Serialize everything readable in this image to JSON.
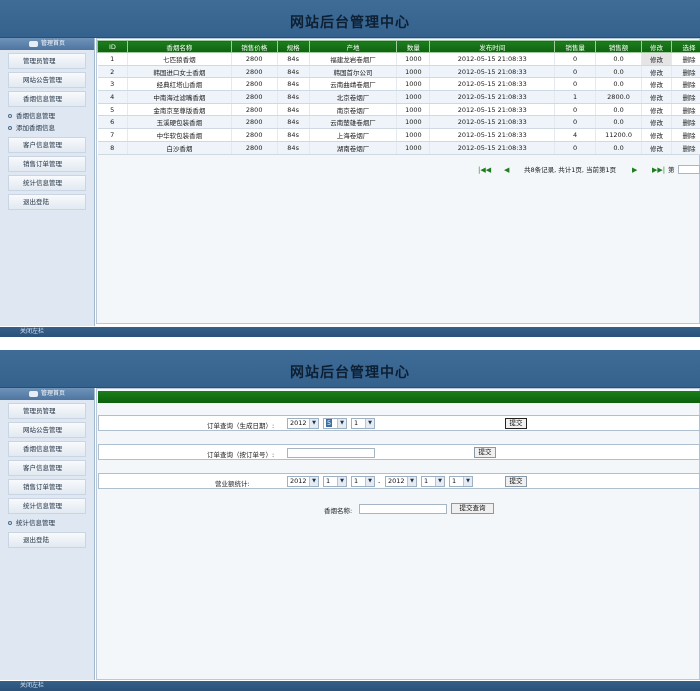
{
  "app": {
    "title": "网站后台管理中心",
    "footer_text": "关闭左栏"
  },
  "sidebar_top": {
    "header": "管理首页",
    "items": [
      "管理员管理",
      "网站公告管理",
      "香烟信息管理"
    ],
    "sub_items": [
      "香烟信息管理",
      "添加香烟信息"
    ],
    "items_after": [
      "客户信息管理",
      "销售订单管理",
      "统计信息管理",
      "退出登陆"
    ]
  },
  "sidebar_bottom": {
    "header": "管理首页",
    "items": [
      "管理员管理",
      "网站公告管理",
      "香烟信息管理",
      "客户信息管理",
      "销售订单管理",
      "统计信息管理"
    ],
    "sub_items": [
      "统计信息管理"
    ],
    "items_after": [
      "退出登陆"
    ]
  },
  "table": {
    "columns": [
      "ID",
      "香烟名称",
      "销售价格",
      "规格",
      "产地",
      "数量",
      "发布时间",
      "销售量",
      "销售额",
      "修改",
      "选择"
    ],
    "rows": [
      [
        "1",
        "七匹狼香烟",
        "2800",
        "84s",
        "福建龙岩卷烟厂",
        "1000",
        "2012-05-15 21:08:33",
        "0",
        "0.0",
        "修改",
        "删除"
      ],
      [
        "2",
        "韩国进口女士香烟",
        "2800",
        "84s",
        "韩国首尔公司",
        "1000",
        "2012-05-15 21:08:33",
        "0",
        "0.0",
        "修改",
        "删除"
      ],
      [
        "3",
        "经典红塔山香烟",
        "2800",
        "84s",
        "云南曲靖卷烟厂",
        "1000",
        "2012-05-15 21:08:33",
        "0",
        "0.0",
        "修改",
        "删除"
      ],
      [
        "4",
        "中南海过滤嘴香烟",
        "2800",
        "84s",
        "北京卷烟厂",
        "1000",
        "2012-05-15 21:08:33",
        "1",
        "2800.0",
        "修改",
        "删除"
      ],
      [
        "5",
        "金南京至尊版香烟",
        "2800",
        "84s",
        "南京卷烟厂",
        "1000",
        "2012-05-15 21:08:33",
        "0",
        "0.0",
        "修改",
        "删除"
      ],
      [
        "6",
        "玉溪硬包装香烟",
        "2800",
        "84s",
        "云南楚雄卷烟厂",
        "1000",
        "2012-05-15 21:08:33",
        "0",
        "0.0",
        "修改",
        "删除"
      ],
      [
        "7",
        "中华软包装香烟",
        "2800",
        "84s",
        "上海卷烟厂",
        "1000",
        "2012-05-15 21:08:33",
        "4",
        "11200.0",
        "修改",
        "删除"
      ],
      [
        "8",
        "白沙香烟",
        "2800",
        "84s",
        "湖南卷烟厂",
        "1000",
        "2012-05-15 21:08:33",
        "0",
        "0.0",
        "修改",
        "删除"
      ]
    ]
  },
  "pager": {
    "info": "共8条记录, 共计1页, 当前第1页",
    "page_label": "第"
  },
  "queries": {
    "by_date": {
      "label": "订单查询（生成日期）:",
      "year": "2012",
      "month": "5",
      "day": "1",
      "submit": "提交"
    },
    "by_number": {
      "label": "订单查询（按订单号）:",
      "value": "",
      "submit": "提交"
    },
    "revenue": {
      "label": "营业额统计:",
      "from_year": "2012",
      "from_month": "1",
      "from_day": "1",
      "sep": "-",
      "to_year": "2012",
      "to_month": "1",
      "to_day": "1",
      "submit": "提交"
    },
    "by_name": {
      "label": "香烟名称:",
      "value": "",
      "submit": "提交查询"
    }
  }
}
